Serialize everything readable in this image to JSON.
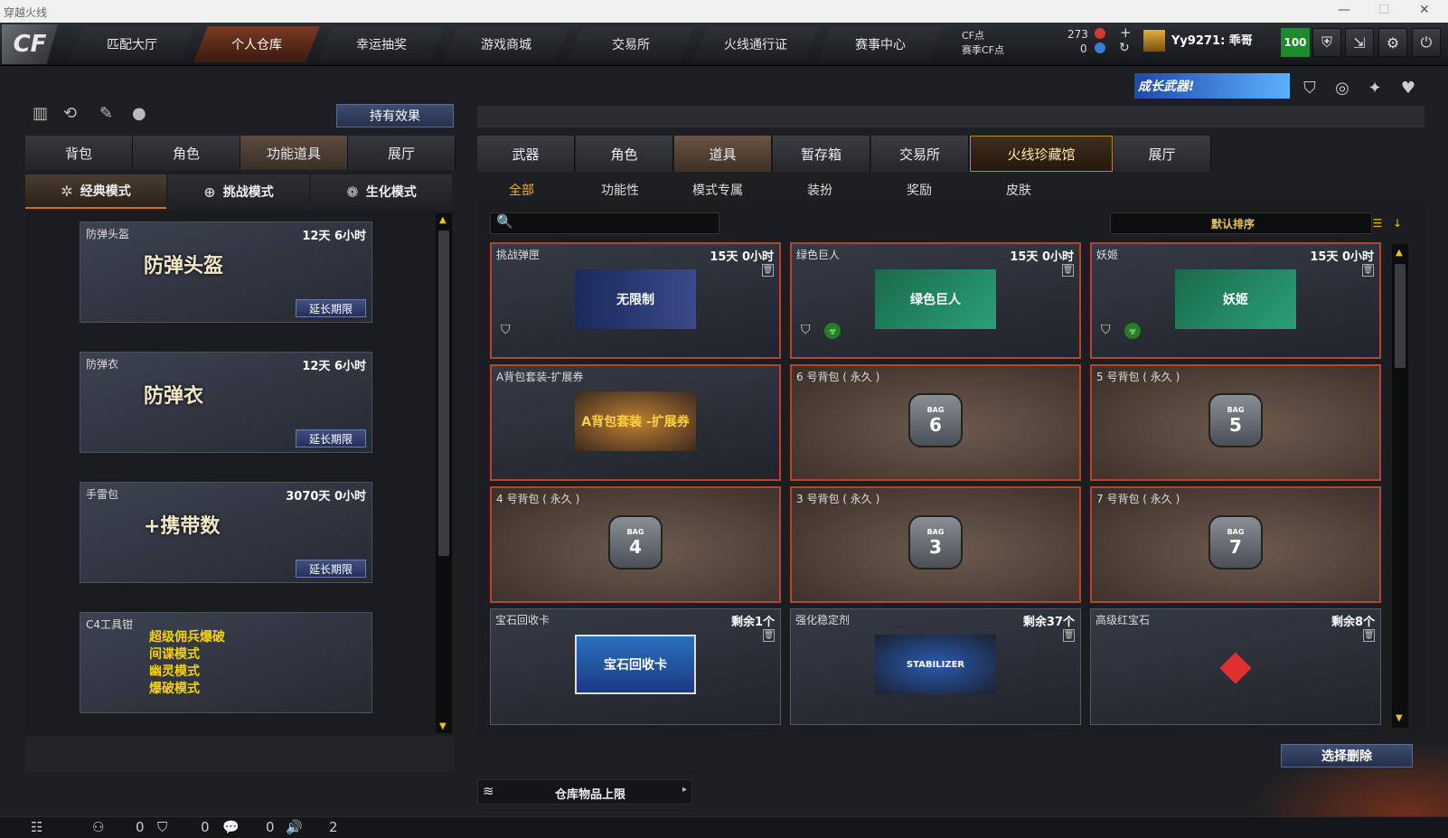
{
  "window": {
    "title": "穿越火线"
  },
  "nav": {
    "tabs": [
      "匹配大厅",
      "个人仓库",
      "幸运抽奖",
      "游戏商城",
      "交易所",
      "火线通行证",
      "赛事中心"
    ],
    "active": 1
  },
  "currency": {
    "cf_label": "CF点",
    "cf_value": "273",
    "season_label": "赛季CF点",
    "season_value": "0"
  },
  "user": {
    "name": "Yy9271: 乖哥",
    "badge": "100"
  },
  "banner": {
    "text": "成长武器!"
  },
  "left": {
    "effects_button": "持有效果",
    "tabs": [
      "背包",
      "角色",
      "功能道具",
      "展厅"
    ],
    "active_tab": 2,
    "modes": [
      "经典模式",
      "挑战模式",
      "生化模式"
    ],
    "active_mode": 0,
    "cards": [
      {
        "name": "防弹头盔",
        "time": "12天 6小时",
        "art": "防弹头盔",
        "action": "延长期限"
      },
      {
        "name": "防弹衣",
        "time": "12天 6小时",
        "art": "防弹衣",
        "action": "延长期限"
      },
      {
        "name": "手雷包",
        "time": "3070天 0小时",
        "art": "+携带数",
        "action": "延长期限"
      },
      {
        "name": "C4工具钳",
        "time": "",
        "lines": [
          "超级佣兵爆破",
          "间谍模式",
          "幽灵模式",
          "爆破模式"
        ]
      }
    ]
  },
  "right": {
    "tabs": [
      "武器",
      "角色",
      "道具",
      "暂存箱",
      "交易所",
      "火线珍藏馆",
      "展厅"
    ],
    "active_tab": 2,
    "gold_tab": 5,
    "subtabs": [
      "全部",
      "功能性",
      "模式专属",
      "装扮",
      "奖励",
      "皮肤"
    ],
    "active_subtab": 0,
    "search_placeholder": "",
    "sort_label": "默认排序",
    "items": [
      {
        "name": "挑战弹匣",
        "time": "15天 0小时",
        "pic": "无限制",
        "type": "ammo"
      },
      {
        "name": "绿色巨人",
        "time": "15天 0小时",
        "pic": "绿色巨人",
        "type": "char"
      },
      {
        "name": "妖姬",
        "time": "15天 0小时",
        "pic": "妖姬",
        "type": "char"
      },
      {
        "name": "A背包套装-扩展券",
        "time": "",
        "pic": "A背包套装 -扩展券",
        "type": "coupon"
      },
      {
        "name": "6 号背包 ( 永久 )",
        "time": "",
        "pic": "6",
        "type": "bag"
      },
      {
        "name": "5 号背包 ( 永久 )",
        "time": "",
        "pic": "5",
        "type": "bag"
      },
      {
        "name": "4 号背包 ( 永久 )",
        "time": "",
        "pic": "4",
        "type": "bag"
      },
      {
        "name": "3 号背包 ( 永久 )",
        "time": "",
        "pic": "3",
        "type": "bag"
      },
      {
        "name": "7 号背包 ( 永久 )",
        "time": "",
        "pic": "7",
        "type": "bag"
      },
      {
        "name": "宝石回收卡",
        "time": "剩余1个",
        "pic": "宝石回收卡",
        "type": "card"
      },
      {
        "name": "强化稳定剂",
        "time": "剩余37个",
        "pic": "STABILIZER",
        "type": "stab"
      },
      {
        "name": "高级红宝石",
        "time": "剩余8个",
        "pic": "",
        "type": "gem"
      }
    ],
    "delete_button": "选择删除",
    "capacity_label": "仓库物品上限"
  },
  "status": {
    "values": [
      "0",
      "0",
      "0",
      "2"
    ]
  },
  "colors": {
    "accent": "#f5b020",
    "highlight_border": "#b2472a",
    "badge": "#1c8a2d"
  }
}
